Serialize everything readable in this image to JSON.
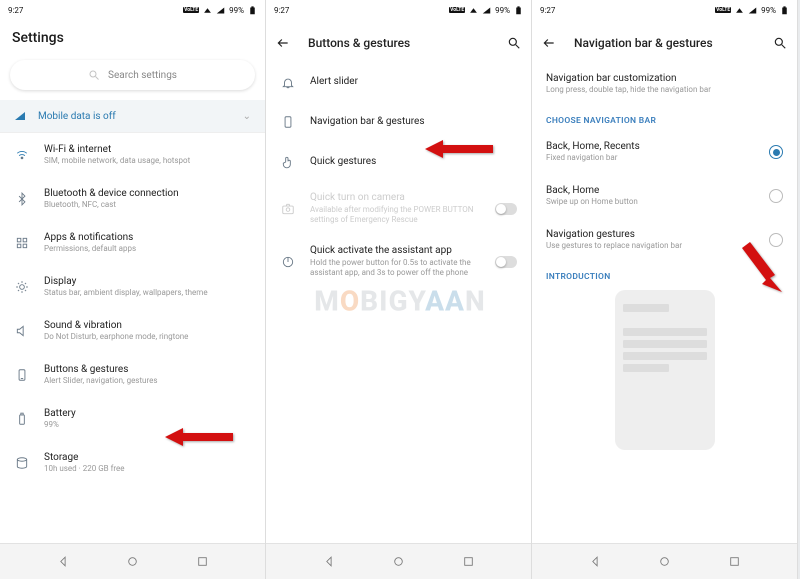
{
  "status": {
    "time": "9:27",
    "battery": "99%"
  },
  "watermark_parts": [
    "M",
    "O",
    "BIGY",
    "A",
    "A",
    "N"
  ],
  "pane1": {
    "title": "Settings",
    "search_placeholder": "Search settings",
    "banner": "Mobile data is off",
    "items": [
      {
        "t": "Wi-Fi & internet",
        "s": "SIM, mobile network, data usage, hotspot"
      },
      {
        "t": "Bluetooth & device connection",
        "s": "Bluetooth, NFC, cast"
      },
      {
        "t": "Apps & notifications",
        "s": "Permissions, default apps"
      },
      {
        "t": "Display",
        "s": "Status bar, ambient display, wallpapers, theme"
      },
      {
        "t": "Sound & vibration",
        "s": "Do Not Disturb, earphone mode, ringtone"
      },
      {
        "t": "Buttons & gestures",
        "s": "Alert Slider, navigation, gestures"
      },
      {
        "t": "Battery",
        "s": "99%"
      },
      {
        "t": "Storage",
        "s": "10h used · 220 GB free"
      }
    ]
  },
  "pane2": {
    "title": "Buttons & gestures",
    "items": [
      {
        "t": "Alert slider"
      },
      {
        "t": "Navigation bar & gestures"
      },
      {
        "t": "Quick gestures"
      },
      {
        "t": "Quick turn on camera",
        "s": "Available after modifying the POWER BUTTON settings of Emergency Rescue",
        "disabled": true,
        "toggle": false
      },
      {
        "t": "Quick activate the assistant app",
        "s": "Hold the power button for 0.5s to activate the assistant app, and 3s to power off the phone",
        "toggle": false
      }
    ]
  },
  "pane3": {
    "title": "Navigation bar & gestures",
    "custom": {
      "t": "Navigation bar customization",
      "s": "Long press, double tap, hide the navigation bar"
    },
    "section_choose": "CHOOSE NAVIGATION BAR",
    "opts": [
      {
        "t": "Back, Home, Recents",
        "s": "Fixed navigation bar",
        "sel": true
      },
      {
        "t": "Back, Home",
        "s": "Swipe up on Home button",
        "sel": false
      },
      {
        "t": "Navigation gestures",
        "s": "Use gestures to replace navigation bar",
        "sel": false
      }
    ],
    "section_intro": "INTRODUCTION"
  }
}
